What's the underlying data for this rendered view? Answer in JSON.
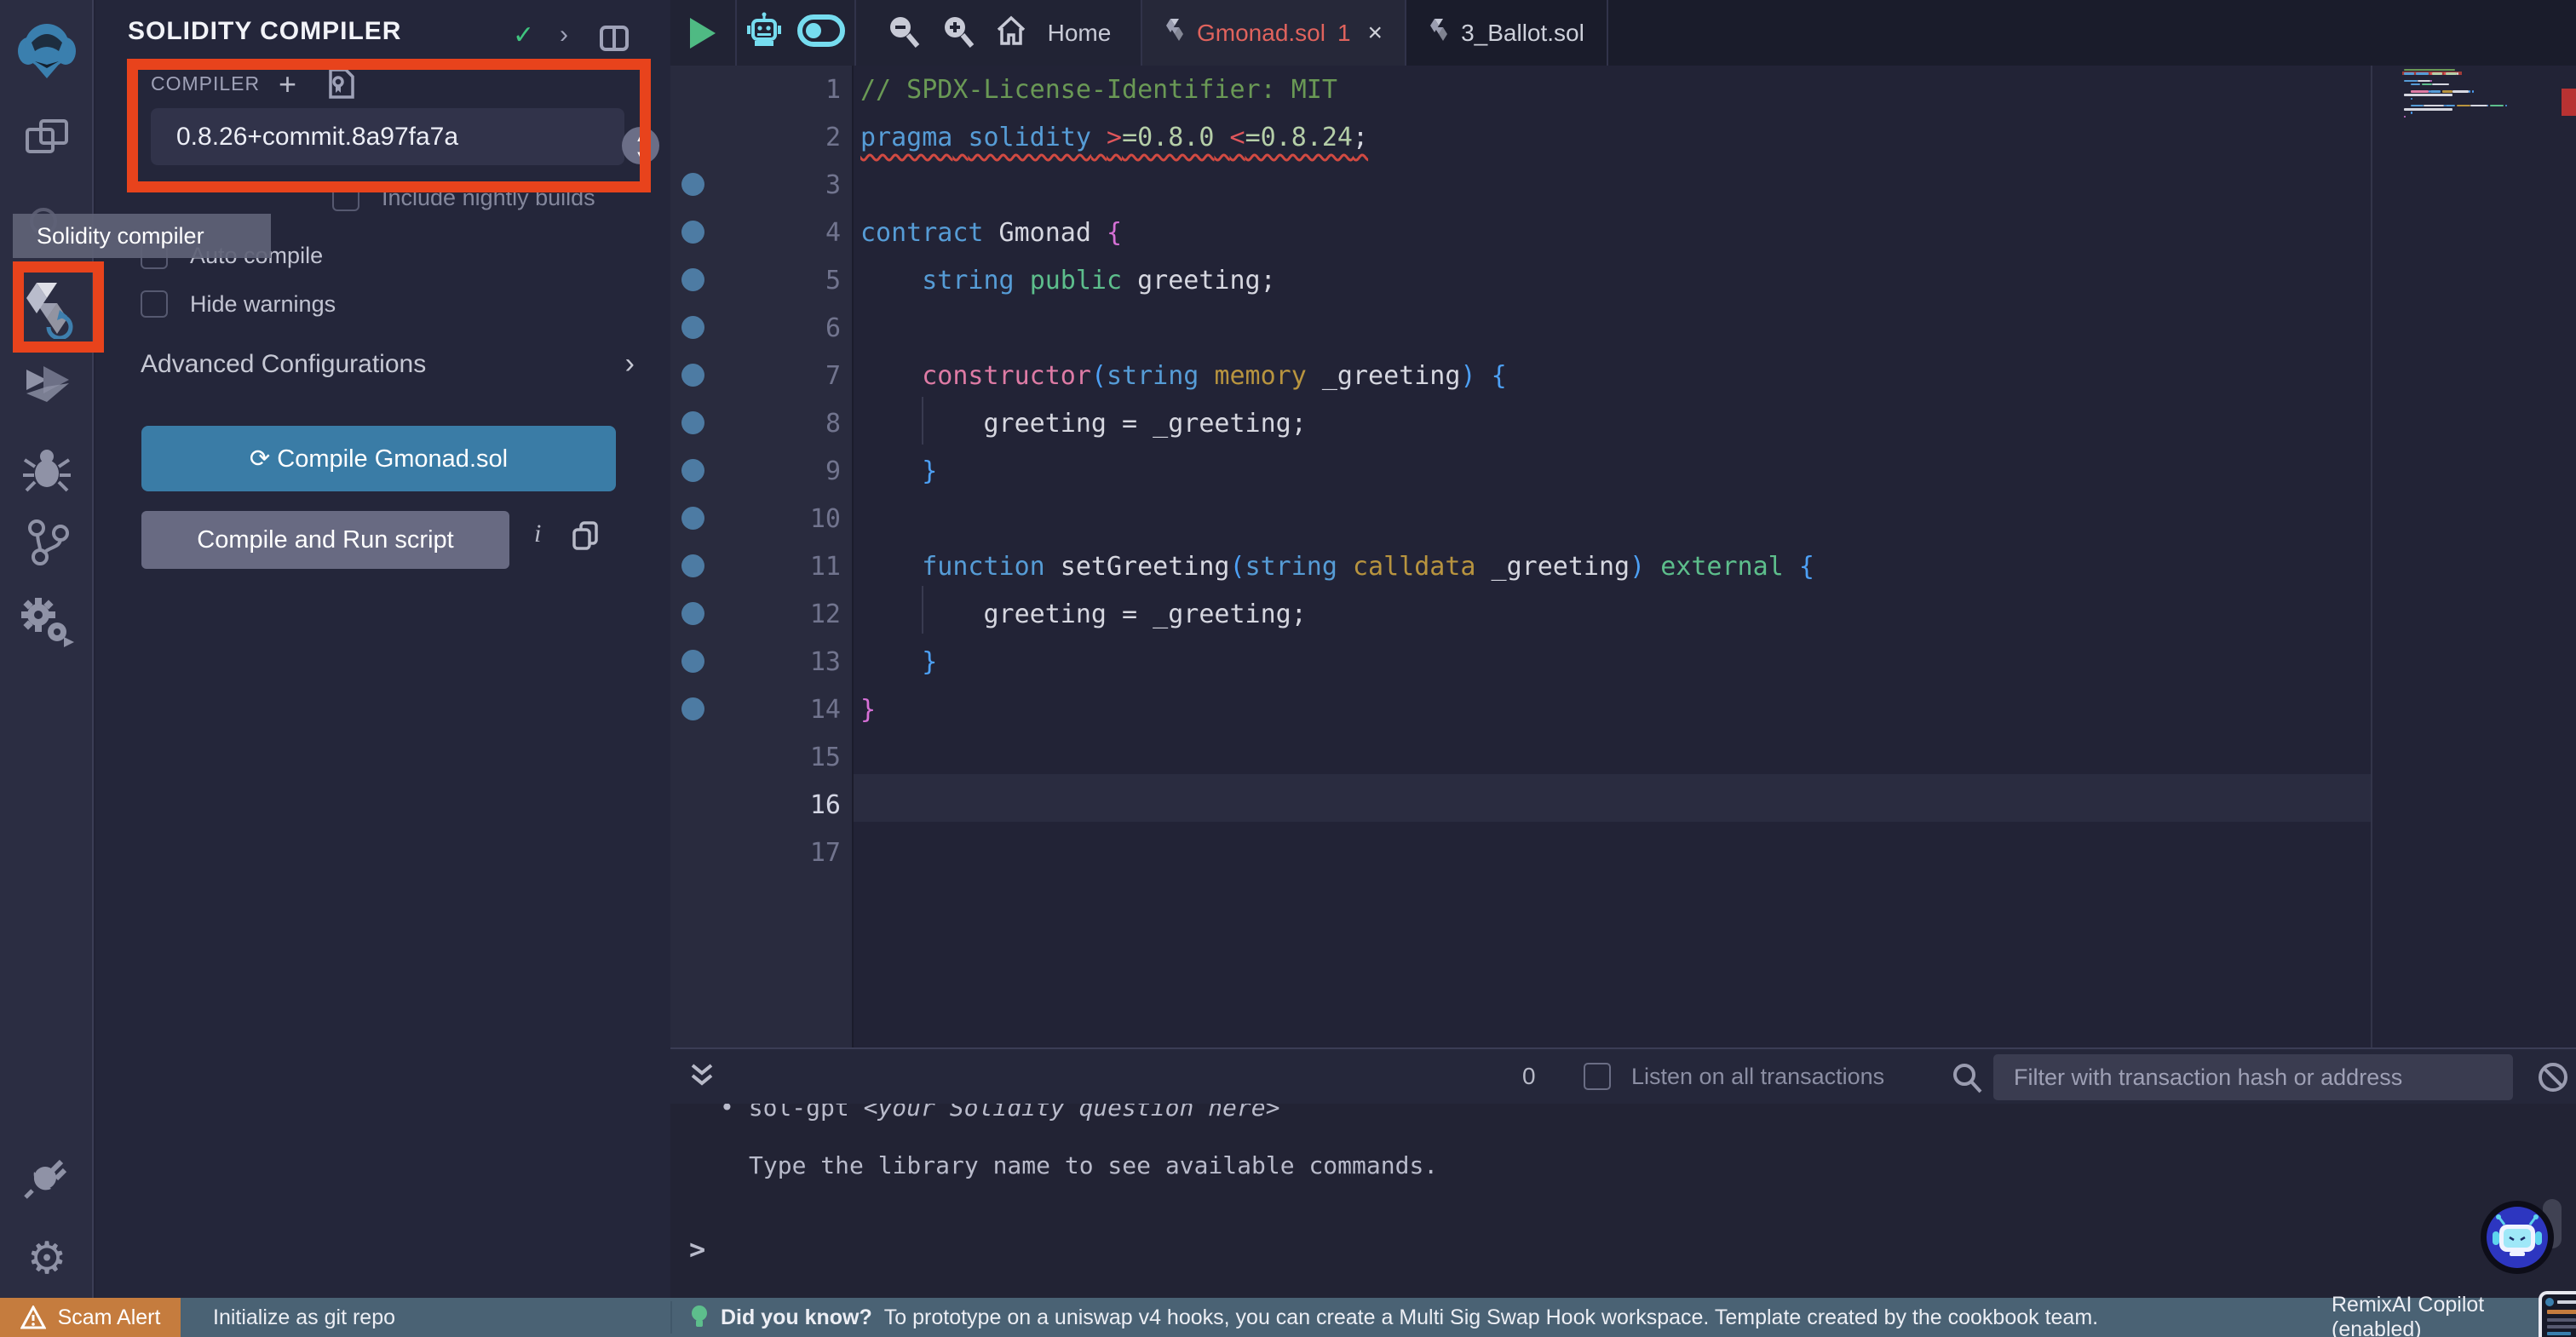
{
  "header": {
    "title": "SOLIDITY COMPILER"
  },
  "compiler": {
    "label": "COMPILER",
    "version": "0.8.26+commit.8a97fa7a",
    "nightly_label": "Include nightly builds",
    "auto_compile_label": "Auto compile",
    "hide_warnings_label": "Hide warnings",
    "advanced_label": "Advanced Configurations",
    "compile_button": "Compile Gmonad.sol",
    "run_button": "Compile and Run script"
  },
  "tooltip": {
    "text": "Solidity compiler"
  },
  "topbar": {
    "home_label": "Home",
    "tabs": [
      {
        "label": "Gmonad.sol",
        "badge": "1",
        "close": true,
        "active": true
      },
      {
        "label": "3_Ballot.sol",
        "badge": "",
        "close": false,
        "active": false
      }
    ]
  },
  "editor": {
    "total_lines": 17,
    "current_line": 16,
    "error_line": 2,
    "dot_lines": [
      3,
      4,
      5,
      6,
      7,
      8,
      9,
      10,
      11,
      12,
      13,
      14
    ],
    "token_colors": {
      "comment": "#6A9955",
      "kw": "#569CD6",
      "op": "#e0565b",
      "num": "#B5CEA8",
      "plain": "#d6d7e0",
      "pink": "#de7ba5",
      "gold": "#b8943f",
      "decl": "#5dbe8c",
      "paren": "#4da0f5",
      "brace1": "#d670d6",
      "brace2": "#4da0f5"
    },
    "lines": [
      [
        [
          "// SPDX-License-Identifier: MIT",
          "comment"
        ]
      ],
      [
        [
          "pragma",
          "kw"
        ],
        [
          " ",
          "plain"
        ],
        [
          "solidity",
          "kw"
        ],
        [
          " ",
          "plain"
        ],
        [
          ">",
          "op"
        ],
        [
          "=0.8.0",
          "num"
        ],
        [
          " ",
          "plain"
        ],
        [
          "<",
          "op"
        ],
        [
          "=0.8.24",
          "num"
        ],
        [
          ";",
          "plain"
        ]
      ],
      [],
      [
        [
          "contract",
          "kw"
        ],
        [
          " Gmonad ",
          "plain"
        ],
        [
          "{",
          "brace1"
        ]
      ],
      [
        [
          "    ",
          "plain"
        ],
        [
          "string",
          "kw"
        ],
        [
          " ",
          "plain"
        ],
        [
          "public",
          "decl"
        ],
        [
          " greeting;",
          "plain"
        ]
      ],
      [],
      [
        [
          "    ",
          "plain"
        ],
        [
          "constructor",
          "pink"
        ],
        [
          "(",
          "paren"
        ],
        [
          "string",
          "kw"
        ],
        [
          " ",
          "plain"
        ],
        [
          "memory",
          "gold"
        ],
        [
          " _greeting",
          "plain"
        ],
        [
          ")",
          "paren"
        ],
        [
          " ",
          "plain"
        ],
        [
          "{",
          "brace2"
        ]
      ],
      [
        [
          "        greeting = _greeting;",
          "plain"
        ]
      ],
      [
        [
          "    ",
          "plain"
        ],
        [
          "}",
          "brace2"
        ]
      ],
      [],
      [
        [
          "    ",
          "plain"
        ],
        [
          "function",
          "kw"
        ],
        [
          " setGreeting",
          "plain"
        ],
        [
          "(",
          "paren"
        ],
        [
          "string",
          "kw"
        ],
        [
          " ",
          "plain"
        ],
        [
          "calldata",
          "gold"
        ],
        [
          " _greeting",
          "plain"
        ],
        [
          ")",
          "paren"
        ],
        [
          " ",
          "plain"
        ],
        [
          "external",
          "decl"
        ],
        [
          " ",
          "plain"
        ],
        [
          "{",
          "brace2"
        ]
      ],
      [
        [
          "        greeting = _greeting;",
          "plain"
        ]
      ],
      [
        [
          "    ",
          "plain"
        ],
        [
          "}",
          "brace2"
        ]
      ],
      [
        [
          "}",
          "brace1"
        ]
      ],
      [],
      [],
      []
    ]
  },
  "terminal": {
    "count": "0",
    "listen_label": "Listen on all transactions",
    "filter_placeholder": "Filter with transaction hash or address",
    "lines": [
      {
        "x": 58,
        "parts": [
          {
            "t": "• sol-gpt ",
            "i": false
          },
          {
            "t": "<your Solidity question here>",
            "i": true
          }
        ]
      },
      {
        "x": 92,
        "parts": [
          {
            "t": "Type the library name to see available commands.",
            "i": false
          }
        ]
      }
    ],
    "prompt": ">"
  },
  "statusbar": {
    "scam_alert": "Scam Alert",
    "git_repo": "Initialize as git repo",
    "tip_title": "Did you know?",
    "tip_text": "To prototype on a uniswap v4 hooks, you can create a Multi Sig Swap Hook workspace. Template created by the cookbook team.",
    "copilot": "RemixAI Copilot (enabled)"
  },
  "colors": {
    "annotation_red": "#e8431c",
    "primary_button": "#3a7ca6",
    "secondary_button": "#686a82",
    "status_bar": "#4a6274",
    "scam_alert_bg": "#c57c3e",
    "active_tab_text": "#e0635d",
    "gutter_dot": "#4d7ba3",
    "cyan_icon": "#76dcef",
    "play_green": "#4fba83",
    "check_green": "#3fc47e",
    "error_marker": "#b83232"
  }
}
